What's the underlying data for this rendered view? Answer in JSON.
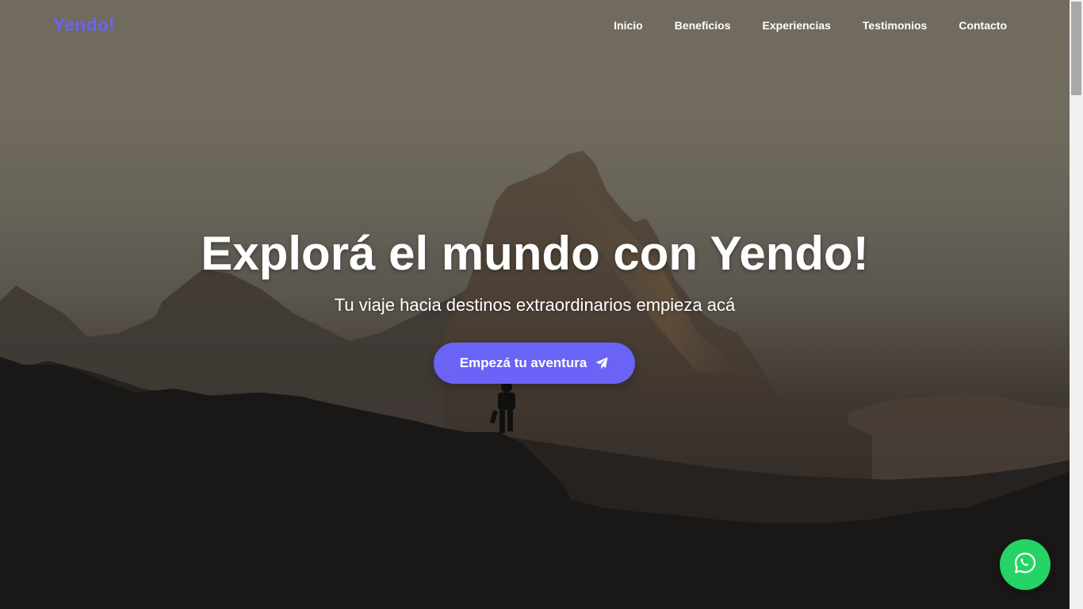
{
  "brand": {
    "logo_text": "Yendo!",
    "accent_color": "#6a63f5"
  },
  "nav": {
    "items": [
      {
        "label": "Inicio"
      },
      {
        "label": "Beneficios"
      },
      {
        "label": "Experiencias"
      },
      {
        "label": "Testimonios"
      },
      {
        "label": "Contacto"
      }
    ]
  },
  "hero": {
    "title": "Explorá el mundo con Yendo!",
    "subtitle": "Tu viaje hacia destinos extraordinarios empieza acá",
    "cta_label": "Empezá tu aventura",
    "cta_icon": "paper-plane-icon",
    "background": "mountain-silhouette-hiker"
  },
  "floating": {
    "whatsapp_icon": "whatsapp-icon",
    "whatsapp_color": "#25d366"
  }
}
